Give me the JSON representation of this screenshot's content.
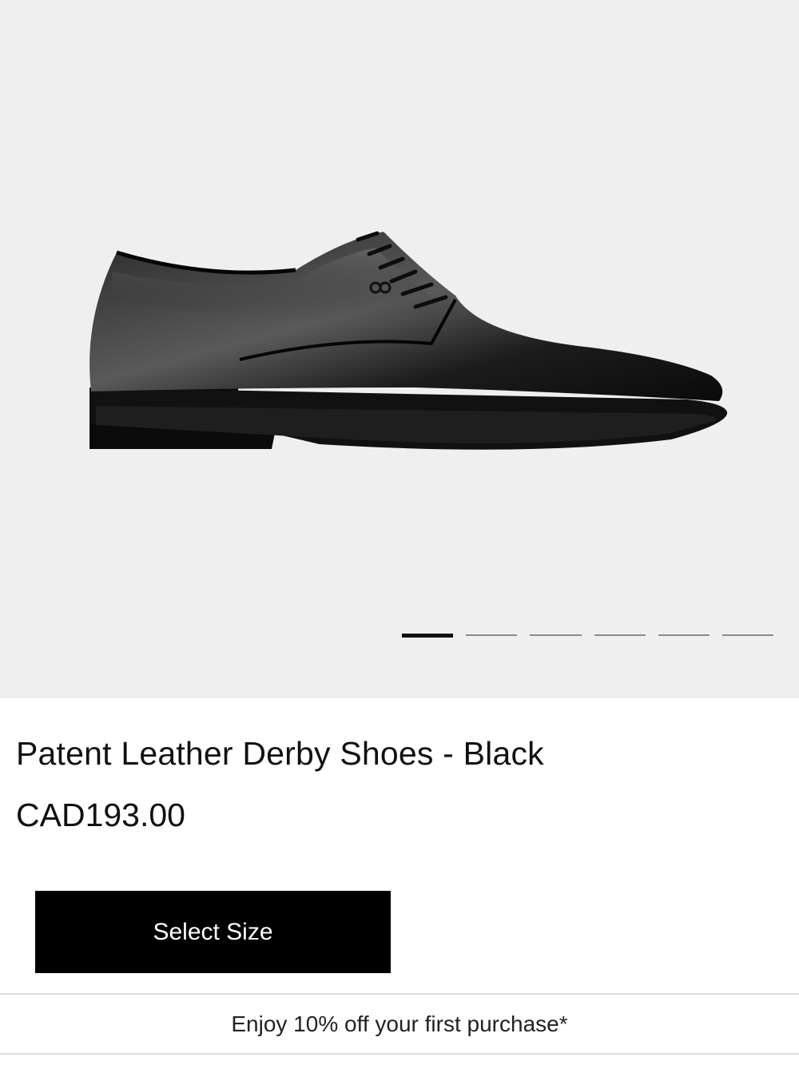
{
  "product": {
    "title": "Patent Leather Derby Shoes - Black",
    "price": "CAD193.00",
    "image_icon": "shoe-photo"
  },
  "gallery": {
    "image_count": 6,
    "active_index": 0
  },
  "actions": {
    "select_size_label": "Select Size"
  },
  "promo": {
    "text": "Enjoy 10% off your first purchase*"
  },
  "colors": {
    "gallery_bg": "#efefef",
    "button_bg": "#000000",
    "button_text": "#ffffff",
    "text": "#111111"
  }
}
